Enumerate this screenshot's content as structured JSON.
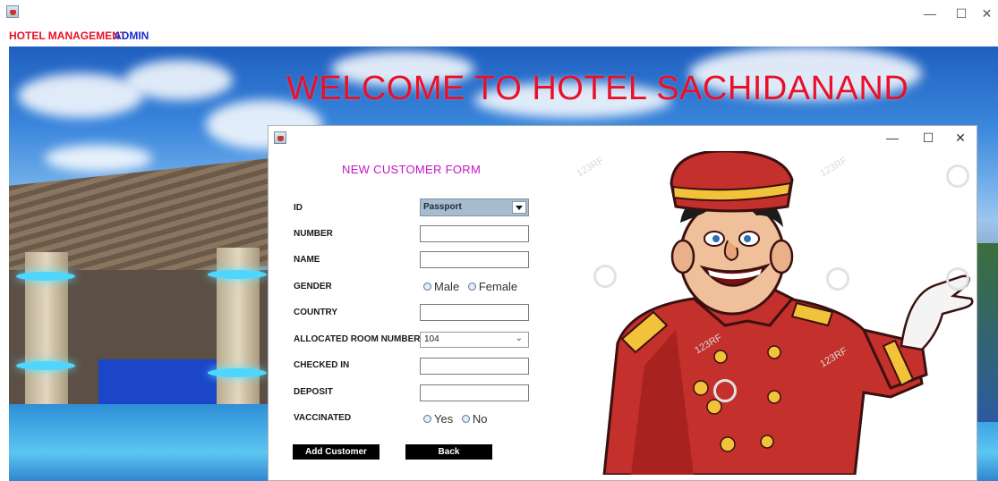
{
  "outer_window": {
    "menu": [
      "HOTEL MANAGEMENT",
      "ADMIN"
    ],
    "controls": {
      "minimize": "—",
      "maximize": "☐",
      "close": "✕"
    }
  },
  "banner": {
    "title": "WELCOME TO HOTEL SACHIDANAND"
  },
  "form_window": {
    "controls": {
      "minimize": "—",
      "maximize": "☐",
      "close": "✕"
    },
    "heading": "NEW CUSTOMER FORM",
    "fields": {
      "id_label": "ID",
      "id_value": "Passport",
      "number_label": "NUMBER",
      "number_value": "",
      "name_label": "NAME",
      "name_value": "",
      "gender_label": "GENDER",
      "gender_options": [
        "Male",
        "Female"
      ],
      "country_label": "COUNTRY",
      "country_value": "",
      "room_label": "ALLOCATED ROOM NUMBER",
      "room_value": "104",
      "checked_in_label": "CHECKED IN",
      "checked_in_value": "",
      "deposit_label": "DEPOSIT",
      "deposit_value": "",
      "vaccinated_label": "VACCINATED",
      "vaccinated_options": [
        "Yes",
        "No"
      ]
    },
    "buttons": {
      "add": "Add Customer",
      "back": "Back"
    },
    "watermark": "123RF"
  },
  "colors": {
    "menu_hotel": "#e8102a",
    "menu_admin": "#1a2fcf",
    "banner_title": "#e8102a",
    "form_heading": "#c515c5",
    "id_select_bg": "#a9bccf",
    "button_bg": "#000000"
  }
}
